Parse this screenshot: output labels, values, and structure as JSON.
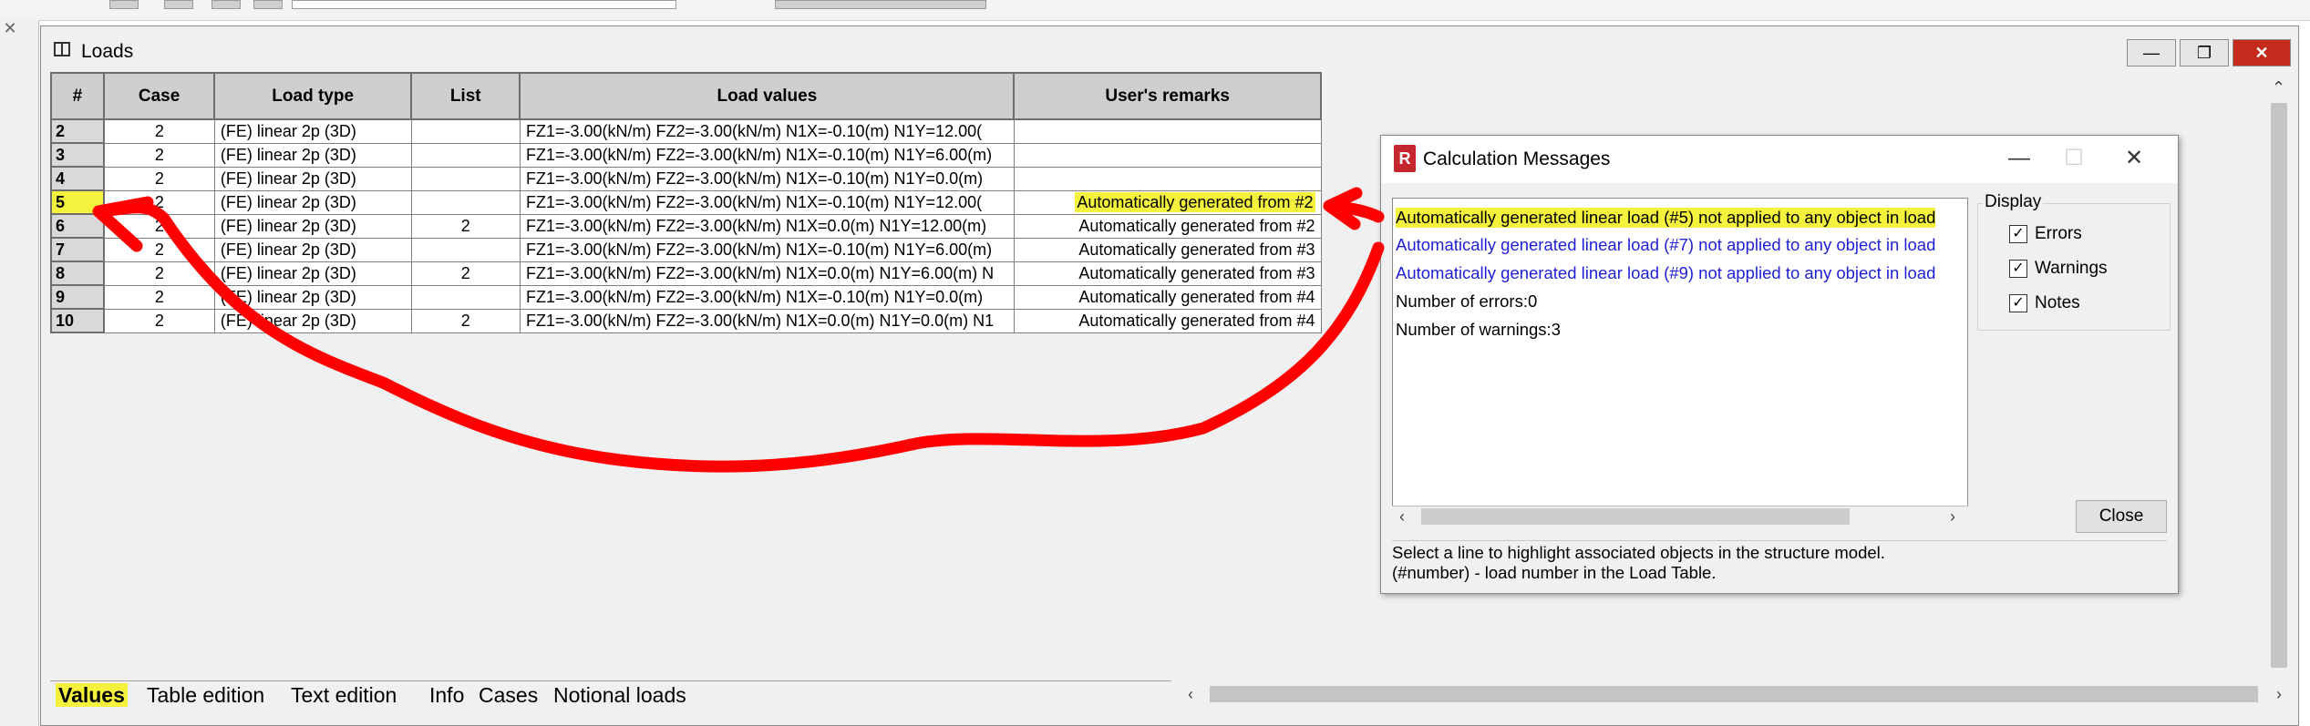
{
  "loads_window": {
    "title": "Loads",
    "minimize_icon": "minimize-icon",
    "maximize_icon": "maximize-icon",
    "close_icon": "close-icon"
  },
  "table": {
    "headers": [
      "#",
      "Case",
      "Load type",
      "List",
      "Load values",
      "User's remarks"
    ],
    "rows": [
      {
        "num": "2",
        "case": "2",
        "type": "(FE) linear 2p (3D)",
        "list": "",
        "values": "FZ1=-3.00(kN/m) FZ2=-3.00(kN/m) N1X=-0.10(m) N1Y=12.00(",
        "remarks": ""
      },
      {
        "num": "3",
        "case": "2",
        "type": "(FE) linear 2p (3D)",
        "list": "",
        "values": "FZ1=-3.00(kN/m) FZ2=-3.00(kN/m) N1X=-0.10(m) N1Y=6.00(m)",
        "remarks": ""
      },
      {
        "num": "4",
        "case": "2",
        "type": "(FE) linear 2p (3D)",
        "list": "",
        "values": "FZ1=-3.00(kN/m) FZ2=-3.00(kN/m) N1X=-0.10(m) N1Y=0.0(m)",
        "remarks": ""
      },
      {
        "num": "5",
        "case": "2",
        "type": "(FE) linear 2p (3D)",
        "list": "",
        "values": "FZ1=-3.00(kN/m) FZ2=-3.00(kN/m) N1X=-0.10(m) N1Y=12.00(",
        "remarks": "Automatically generated from #2"
      },
      {
        "num": "6",
        "case": "2",
        "type": "(FE) linear 2p (3D)",
        "list": "2",
        "values": "FZ1=-3.00(kN/m) FZ2=-3.00(kN/m) N1X=0.0(m) N1Y=12.00(m)",
        "remarks": "Automatically generated from #2"
      },
      {
        "num": "7",
        "case": "2",
        "type": "(FE) linear 2p (3D)",
        "list": "",
        "values": "FZ1=-3.00(kN/m) FZ2=-3.00(kN/m) N1X=-0.10(m) N1Y=6.00(m)",
        "remarks": "Automatically generated from #3"
      },
      {
        "num": "8",
        "case": "2",
        "type": "(FE) linear 2p (3D)",
        "list": "2",
        "values": "FZ1=-3.00(kN/m) FZ2=-3.00(kN/m) N1X=0.0(m) N1Y=6.00(m) N",
        "remarks": "Automatically generated from #3"
      },
      {
        "num": "9",
        "case": "2",
        "type": "(FE) linear 2p (3D)",
        "list": "",
        "values": "FZ1=-3.00(kN/m) FZ2=-3.00(kN/m) N1X=-0.10(m) N1Y=0.0(m)",
        "remarks": "Automatically generated from #4"
      },
      {
        "num": "10",
        "case": "2",
        "type": "(FE) linear 2p (3D)",
        "list": "2",
        "values": "FZ1=-3.00(kN/m) FZ2=-3.00(kN/m) N1X=0.0(m) N1Y=0.0(m) N1",
        "remarks": "Automatically generated from #4"
      }
    ]
  },
  "tabs": [
    "Values",
    "Table edition",
    "Text edition",
    "Info",
    "Cases",
    "Notional loads"
  ],
  "dialog": {
    "title": "Calculation Messages",
    "app_icon": "R",
    "messages": [
      "Automatically generated linear load (#5) not applied to any object in load",
      "Automatically generated linear load (#7) not applied to any object in load",
      "Automatically generated linear load (#9) not applied to any object in load",
      "Number of errors:0",
      "Number of warnings:3"
    ],
    "display_label": "Display",
    "checkboxes": [
      {
        "label": "Errors",
        "checked": true
      },
      {
        "label": "Warnings",
        "checked": true
      },
      {
        "label": "Notes",
        "checked": true
      }
    ],
    "close_label": "Close",
    "help_line1": "Select a line to highlight associated objects in the structure model.",
    "help_line2": "(#number) - load number in the Load Table."
  },
  "colors": {
    "highlight": "#f4f23c",
    "annotation": "#ff0000",
    "warning_text": "#1f1fd6"
  }
}
